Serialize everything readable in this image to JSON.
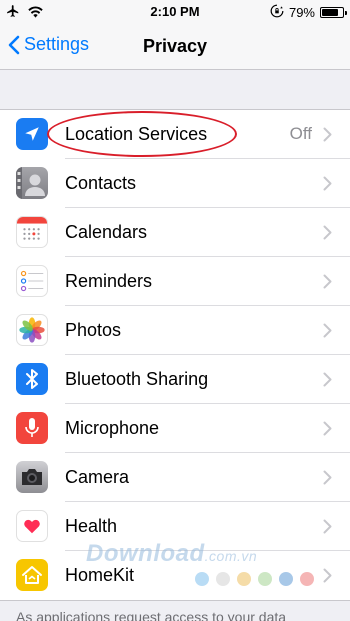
{
  "status_bar": {
    "time": "2:10 PM",
    "battery": "79%",
    "battery_level": 0.79,
    "icons": [
      "airplane-icon",
      "wifi-icon",
      "orientation-lock-icon",
      "battery-icon"
    ]
  },
  "nav": {
    "back_label": "Settings",
    "title": "Privacy"
  },
  "rows": [
    {
      "label": "Location Services",
      "value": "Off",
      "icon": "location-arrow-icon",
      "color": "#1a7cf2"
    },
    {
      "label": "Contacts",
      "value": "",
      "icon": "contacts-icon",
      "color": "#8e8e93"
    },
    {
      "label": "Calendars",
      "value": "",
      "icon": "calendar-icon",
      "color": "#ffffff"
    },
    {
      "label": "Reminders",
      "value": "",
      "icon": "reminders-icon",
      "color": "#ffffff"
    },
    {
      "label": "Photos",
      "value": "",
      "icon": "photos-icon",
      "color": "#ffffff"
    },
    {
      "label": "Bluetooth Sharing",
      "value": "",
      "icon": "bluetooth-icon",
      "color": "#1a7cf2"
    },
    {
      "label": "Microphone",
      "value": "",
      "icon": "microphone-icon",
      "color": "#f2453d"
    },
    {
      "label": "Camera",
      "value": "",
      "icon": "camera-icon",
      "color": "#8e8e93"
    },
    {
      "label": "Health",
      "value": "",
      "icon": "health-heart-icon",
      "color": "#ffffff"
    },
    {
      "label": "HomeKit",
      "value": "",
      "icon": "homekit-icon",
      "color": "#f7c600"
    }
  ],
  "footer_text": "As applications request access to your data",
  "watermark": {
    "main": "Download",
    "suffix": ".com.vn",
    "dot_colors": [
      "#b9dcf5",
      "#e6e6e6",
      "#f5dca8",
      "#cde7c4",
      "#a8c8e8",
      "#f5b5b5"
    ]
  },
  "colors": {
    "accent": "#007aff",
    "annotation": "#d91e2a"
  }
}
